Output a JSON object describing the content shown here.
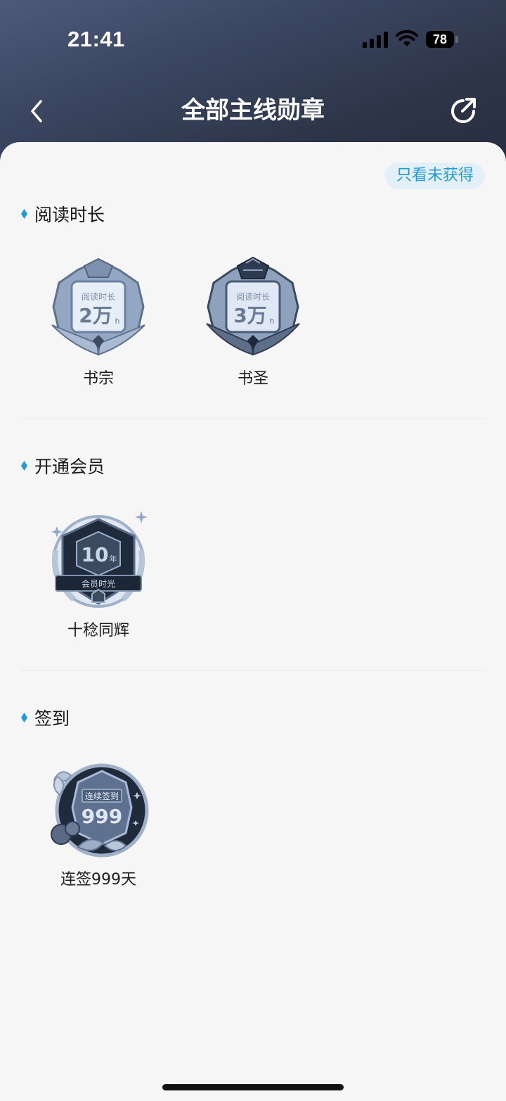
{
  "status_bar": {
    "time": "21:41",
    "battery_level": "78"
  },
  "nav": {
    "title": "全部主线勋章"
  },
  "filter": {
    "label": "只看未获得"
  },
  "colors": {
    "accent": "#1e9be0",
    "header_dark": "#2c3447",
    "sheet_bg": "#f6f6f6"
  },
  "sections": [
    {
      "title": "阅读时长",
      "badges": [
        {
          "name": "书宗",
          "caption": "阅读时长",
          "value": "2万",
          "unit": "h",
          "icon": "reading-hours-badge-icon"
        },
        {
          "name": "书圣",
          "caption": "阅读时长",
          "value": "3万",
          "unit": "h",
          "icon": "reading-hours-badge-icon"
        }
      ]
    },
    {
      "title": "开通会员",
      "badges": [
        {
          "name": "十稔同辉",
          "value": "10",
          "unit": "年",
          "caption": "会员时光",
          "icon": "membership-badge-icon"
        }
      ]
    },
    {
      "title": "签到",
      "badges": [
        {
          "name": "连签999天",
          "caption": "连续签到",
          "value": "999",
          "icon": "checkin-badge-icon"
        }
      ]
    }
  ]
}
